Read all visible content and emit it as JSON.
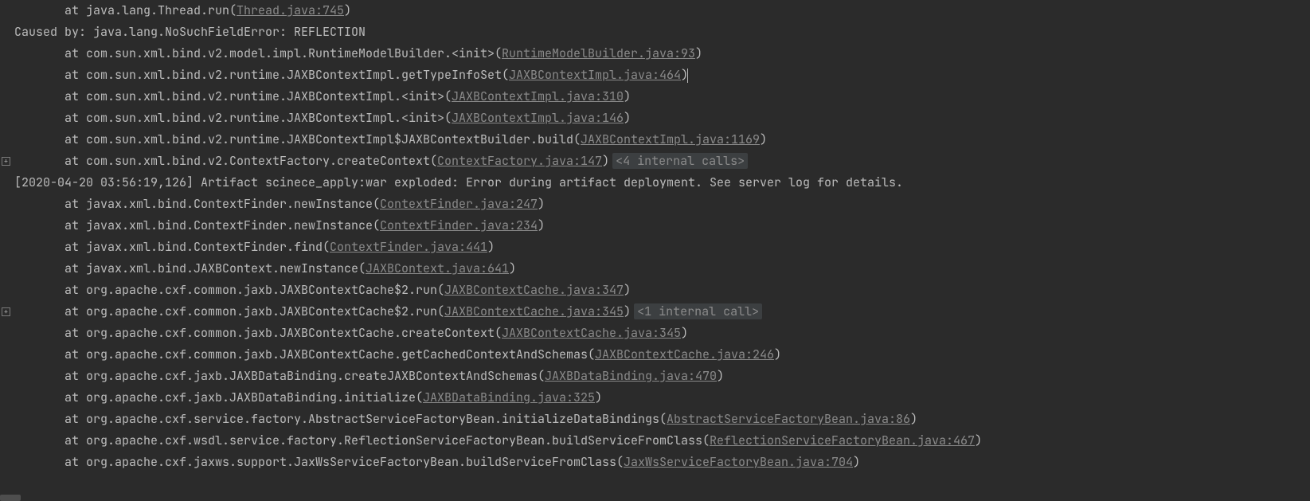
{
  "indent": "       ",
  "at_prefix": "at ",
  "lines": [
    {
      "type": "frame",
      "text": "java.lang.Thread.run",
      "link": "Thread.java:745",
      "expand": false
    },
    {
      "type": "msg",
      "text": "Caused by: java.lang.NoSuchFieldError: REFLECTION"
    },
    {
      "type": "frame",
      "text": "com.sun.xml.bind.v2.model.impl.RuntimeModelBuilder.<init>",
      "link": "RuntimeModelBuilder.java:93",
      "expand": false
    },
    {
      "type": "frame",
      "text": "com.sun.xml.bind.v2.runtime.JAXBContextImpl.getTypeInfoSet",
      "link": "JAXBContextImpl.java:464",
      "caret": true,
      "expand": false
    },
    {
      "type": "frame",
      "text": "com.sun.xml.bind.v2.runtime.JAXBContextImpl.<init>",
      "link": "JAXBContextImpl.java:310",
      "expand": false
    },
    {
      "type": "frame",
      "text": "com.sun.xml.bind.v2.runtime.JAXBContextImpl.<init>",
      "link": "JAXBContextImpl.java:146",
      "expand": false
    },
    {
      "type": "frame",
      "text": "com.sun.xml.bind.v2.runtime.JAXBContextImpl$JAXBContextBuilder.build",
      "link": "JAXBContextImpl.java:1169",
      "expand": false
    },
    {
      "type": "frame",
      "text": "com.sun.xml.bind.v2.ContextFactory.createContext",
      "link": "ContextFactory.java:147",
      "fold": "<4 internal calls>",
      "expand": true
    },
    {
      "type": "msg",
      "text": "[2020-04-20 03:56:19,126] Artifact scinece_apply:war exploded: Error during artifact deployment. See server log for details."
    },
    {
      "type": "frame",
      "text": "javax.xml.bind.ContextFinder.newInstance",
      "link": "ContextFinder.java:247",
      "expand": false
    },
    {
      "type": "frame",
      "text": "javax.xml.bind.ContextFinder.newInstance",
      "link": "ContextFinder.java:234",
      "expand": false
    },
    {
      "type": "frame",
      "text": "javax.xml.bind.ContextFinder.find",
      "link": "ContextFinder.java:441",
      "expand": false
    },
    {
      "type": "frame",
      "text": "javax.xml.bind.JAXBContext.newInstance",
      "link": "JAXBContext.java:641",
      "expand": false
    },
    {
      "type": "frame",
      "text": "org.apache.cxf.common.jaxb.JAXBContextCache$2.run",
      "link": "JAXBContextCache.java:347",
      "expand": false
    },
    {
      "type": "frame",
      "text": "org.apache.cxf.common.jaxb.JAXBContextCache$2.run",
      "link": "JAXBContextCache.java:345",
      "fold": "<1 internal call>",
      "expand": true
    },
    {
      "type": "frame",
      "text": "org.apache.cxf.common.jaxb.JAXBContextCache.createContext",
      "link": "JAXBContextCache.java:345",
      "expand": false
    },
    {
      "type": "frame",
      "text": "org.apache.cxf.common.jaxb.JAXBContextCache.getCachedContextAndSchemas",
      "link": "JAXBContextCache.java:246",
      "expand": false
    },
    {
      "type": "frame",
      "text": "org.apache.cxf.jaxb.JAXBDataBinding.createJAXBContextAndSchemas",
      "link": "JAXBDataBinding.java:470",
      "expand": false
    },
    {
      "type": "frame",
      "text": "org.apache.cxf.jaxb.JAXBDataBinding.initialize",
      "link": "JAXBDataBinding.java:325",
      "expand": false
    },
    {
      "type": "frame",
      "text": "org.apache.cxf.service.factory.AbstractServiceFactoryBean.initializeDataBindings",
      "link": "AbstractServiceFactoryBean.java:86",
      "expand": false
    },
    {
      "type": "frame",
      "text": "org.apache.cxf.wsdl.service.factory.ReflectionServiceFactoryBean.buildServiceFromClass",
      "link": "ReflectionServiceFactoryBean.java:467",
      "expand": false
    },
    {
      "type": "frame",
      "text": "org.apache.cxf.jaxws.support.JaxWsServiceFactoryBean.buildServiceFromClass",
      "link": "JaxWsServiceFactoryBean.java:704",
      "expand": false
    }
  ],
  "icons": {
    "expand_glyph": "+"
  }
}
